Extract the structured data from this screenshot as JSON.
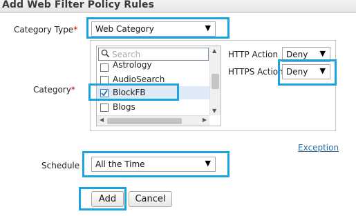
{
  "window": {
    "title": "Add Web Filter Policy Rules"
  },
  "form": {
    "category_type": {
      "label": "Category Type",
      "required_mark": "*",
      "value": "Web Category"
    },
    "category": {
      "label": "Category",
      "required_mark": "*",
      "search_placeholder": "Search",
      "items": [
        {
          "label": "Astrology",
          "checked": false
        },
        {
          "label": "AudioSearch",
          "checked": false
        },
        {
          "label": "BlockFB",
          "checked": true
        },
        {
          "label": "Blogs",
          "checked": false
        }
      ]
    },
    "http_action": {
      "label": "HTTP Action",
      "value": "Deny"
    },
    "https_action": {
      "label": "HTTPS Action",
      "value": "Deny"
    },
    "exception_link": "Exception",
    "schedule": {
      "label": "Schedule",
      "value": "All the Time"
    }
  },
  "buttons": {
    "add": "Add",
    "cancel": "Cancel"
  },
  "colors": {
    "highlight": "#1aa3dc",
    "required": "#cc0000",
    "link": "#2d6a9f"
  },
  "icons": {
    "search": "search-icon",
    "check": "checkmark-icon",
    "dropdown": "dropdown-arrow-icon"
  }
}
